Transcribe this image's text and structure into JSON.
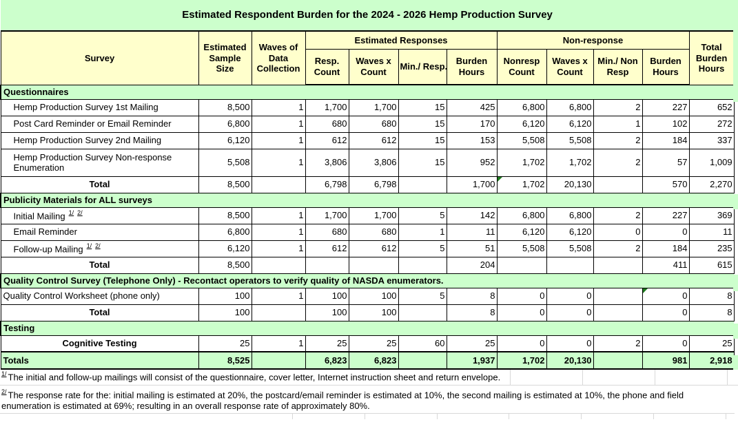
{
  "title": "Estimated Respondent Burden for the 2024 - 2026 Hemp Production Survey",
  "colors": {
    "band_green": "#ccffcc",
    "header_yellow": "#ffffcc",
    "border_black": "#000000",
    "flag_green": "#1e7a1e",
    "gridline_gray": "#d8d8d8"
  },
  "header": {
    "survey": "Survey",
    "sample_size": "Estimated Sample Size",
    "waves": "Waves of Data Collection",
    "groups": {
      "responses": "Estimated Responses",
      "nonresponse": "Non-response"
    },
    "sub": [
      "Resp. Count",
      "Waves x Count",
      "Min./ Resp.",
      "Burden Hours",
      "Nonresp Count",
      "Waves x Count",
      "Min./ Non Resp",
      "Burden Hours"
    ],
    "total_burden": "Total Burden Hours"
  },
  "sections": [
    {
      "title": "Questionnaires",
      "rows": [
        {
          "label": "Hemp Production Survey 1st Mailing",
          "style": "indent",
          "values": [
            "8,500",
            "1",
            "1,700",
            "1,700",
            "15",
            "425",
            "6,800",
            "6,800",
            "2",
            "227",
            "652"
          ]
        },
        {
          "label": "Post Card Reminder or Email Reminder",
          "style": "indent",
          "values": [
            "6,800",
            "1",
            "680",
            "680",
            "15",
            "170",
            "6,120",
            "6,120",
            "1",
            "102",
            "272"
          ]
        },
        {
          "label": "Hemp Production Survey 2nd Mailing",
          "style": "indent",
          "values": [
            "6,120",
            "1",
            "612",
            "612",
            "15",
            "153",
            "5,508",
            "5,508",
            "2",
            "184",
            "337"
          ]
        },
        {
          "label": "Hemp Production Survey Non-response Enumeration",
          "style": "indent",
          "tall": true,
          "values": [
            "5,508",
            "1",
            "3,806",
            "3,806",
            "15",
            "952",
            "1,702",
            "1,702",
            "2",
            "57",
            "1,009"
          ]
        },
        {
          "label": "Total",
          "style": "total",
          "flag_col": 6,
          "values": [
            "8,500",
            "",
            "6,798",
            "6,798",
            "",
            "1,700",
            "1,702",
            "20,130",
            "",
            "570",
            "2,270"
          ]
        }
      ]
    },
    {
      "title": "Publicity Materials for ALL surveys",
      "rows": [
        {
          "label": "Initial Mailing",
          "sups": [
            "1/",
            "2/"
          ],
          "style": "indent",
          "values": [
            "8,500",
            "1",
            "1,700",
            "1,700",
            "5",
            "142",
            "6,800",
            "6,800",
            "2",
            "227",
            "369"
          ]
        },
        {
          "label": "Email Reminder",
          "style": "indent",
          "values": [
            "6,800",
            "1",
            "680",
            "680",
            "1",
            "11",
            "6,120",
            "6,120",
            "0",
            "0",
            "11"
          ]
        },
        {
          "label": "Follow-up Mailing",
          "sups": [
            "1/",
            "2/"
          ],
          "style": "indent",
          "values": [
            "6,120",
            "1",
            "612",
            "612",
            "5",
            "51",
            "5,508",
            "5,508",
            "2",
            "184",
            "235"
          ]
        },
        {
          "label": "Total",
          "style": "total",
          "values": [
            "8,500",
            "",
            "",
            "",
            "",
            "204",
            "",
            "",
            "",
            "411",
            "615"
          ]
        }
      ]
    },
    {
      "title": "Quality Control Survey (Telephone Only) - Recontact operators to verify quality of NASDA enumerators.",
      "rows": [
        {
          "label": "Quality Control Worksheet (phone only)",
          "style": "flush",
          "flag_col": 9,
          "values": [
            "100",
            "1",
            "100",
            "100",
            "5",
            "8",
            "0",
            "0",
            "",
            "0",
            "8"
          ]
        },
        {
          "label": "Total",
          "style": "total",
          "values": [
            "100",
            "",
            "100",
            "100",
            "",
            "8",
            "0",
            "0",
            "",
            "0",
            "8"
          ]
        }
      ]
    },
    {
      "title": "Testing",
      "rows": [
        {
          "label": "Cognitive Testing",
          "style": "total",
          "values": [
            "25",
            "1",
            "25",
            "25",
            "60",
            "25",
            "0",
            "0",
            "2",
            "0",
            "25"
          ]
        }
      ]
    }
  ],
  "totals": {
    "label": "Totals",
    "values": [
      "8,525",
      "",
      "6,823",
      "6,823",
      "",
      "1,937",
      "1,702",
      "20,130",
      "",
      "981",
      "2,918"
    ]
  },
  "footnotes": [
    {
      "mark": "1/",
      "text": "The initial and follow-up mailings will consist of the questionnaire, cover letter, Internet instruction sheet and return envelope."
    },
    {
      "mark": "2/",
      "text": "The response rate for the: initial mailing is estimated at 20%, the postcard/email reminder is estimated at 10%, the second mailing is estimated at 10%, the phone and field enumeration is estimated at 69%; resulting in an overall response rate of approximately 80%."
    }
  ]
}
